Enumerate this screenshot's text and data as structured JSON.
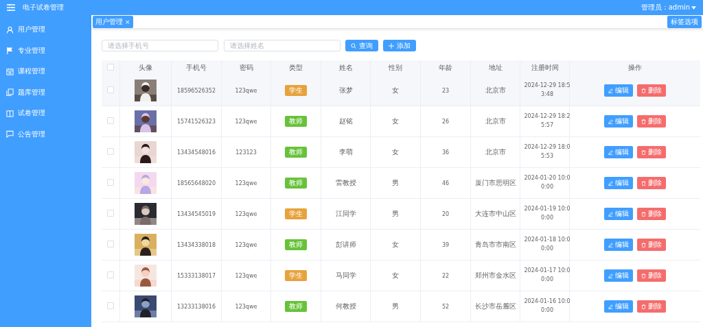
{
  "header": {
    "title": "电子试卷管理",
    "user": "管理员：admin"
  },
  "sidebar": {
    "items": [
      {
        "label": "用户管理"
      },
      {
        "label": "专业管理"
      },
      {
        "label": "课程管理"
      },
      {
        "label": "题库管理"
      },
      {
        "label": "试卷管理"
      },
      {
        "label": "公告管理"
      }
    ]
  },
  "tabs": [
    {
      "label": "用户管理",
      "close": "×",
      "selected": true
    }
  ],
  "tab_options": "标签选项",
  "search": {
    "phone_placeholder": "请选择手机号",
    "name_placeholder": "请选择姓名",
    "query_button": "查询",
    "add_button": "添加"
  },
  "table": {
    "columns": [
      "头像",
      "手机号",
      "密码",
      "类型",
      "姓名",
      "性别",
      "年龄",
      "地址",
      "注册时间",
      "操作"
    ],
    "header_checked": false,
    "rows": [
      {
        "checked": false,
        "phone": "18596526352",
        "password": "123qwe",
        "type": {
          "label": "学生",
          "kind": "student"
        },
        "name": "张梦",
        "gender": "女",
        "age": "23",
        "address": "北京市",
        "registered": "2024-12-29 18:53:48",
        "edit": "编辑",
        "delete": "删除"
      },
      {
        "checked": false,
        "phone": "15741526323",
        "password": "123qwe",
        "type": {
          "label": "教师",
          "kind": "teacher"
        },
        "name": "赵铭",
        "gender": "女",
        "age": "26",
        "address": "北京市",
        "registered": "2024-12-29 18:25:57",
        "edit": "编辑",
        "delete": "删除"
      },
      {
        "checked": false,
        "phone": "13434548016",
        "password": "123123",
        "type": {
          "label": "教师",
          "kind": "teacher"
        },
        "name": "李萌",
        "gender": "女",
        "age": "36",
        "address": "北京市",
        "registered": "2024-12-29 18:05:53",
        "edit": "编辑",
        "delete": "删除"
      },
      {
        "checked": false,
        "phone": "18565648020",
        "password": "123qwe",
        "type": {
          "label": "教师",
          "kind": "teacher"
        },
        "name": "雷教授",
        "gender": "男",
        "age": "46",
        "address": "厦门市思明区",
        "registered": "2024-01-20 10:00:00",
        "edit": "编辑",
        "delete": "删除"
      },
      {
        "checked": false,
        "phone": "13434545019",
        "password": "123qwe",
        "type": {
          "label": "学生",
          "kind": "student"
        },
        "name": "江同学",
        "gender": "男",
        "age": "20",
        "address": "大连市中山区",
        "registered": "2024-01-19 10:00:00",
        "edit": "编辑",
        "delete": "删除"
      },
      {
        "checked": false,
        "phone": "13434338018",
        "password": "123qwe",
        "type": {
          "label": "教师",
          "kind": "teacher"
        },
        "name": "彭讲师",
        "gender": "女",
        "age": "39",
        "address": "青岛市市南区",
        "registered": "2024-01-18 10:00:00",
        "edit": "编辑",
        "delete": "删除"
      },
      {
        "checked": false,
        "phone": "15333138017",
        "password": "123qwe",
        "type": {
          "label": "学生",
          "kind": "student"
        },
        "name": "马同学",
        "gender": "女",
        "age": "22",
        "address": "郑州市金水区",
        "registered": "2024-01-17 10:00:00",
        "edit": "编辑",
        "delete": "删除"
      },
      {
        "checked": false,
        "phone": "13233138016",
        "password": "123qwe",
        "type": {
          "label": "教师",
          "kind": "teacher"
        },
        "name": "何教授",
        "gender": "男",
        "age": "52",
        "address": "长沙市岳麓区",
        "registered": "2024-01-16 10:00:00",
        "edit": "编辑",
        "delete": "删除"
      }
    ]
  }
}
